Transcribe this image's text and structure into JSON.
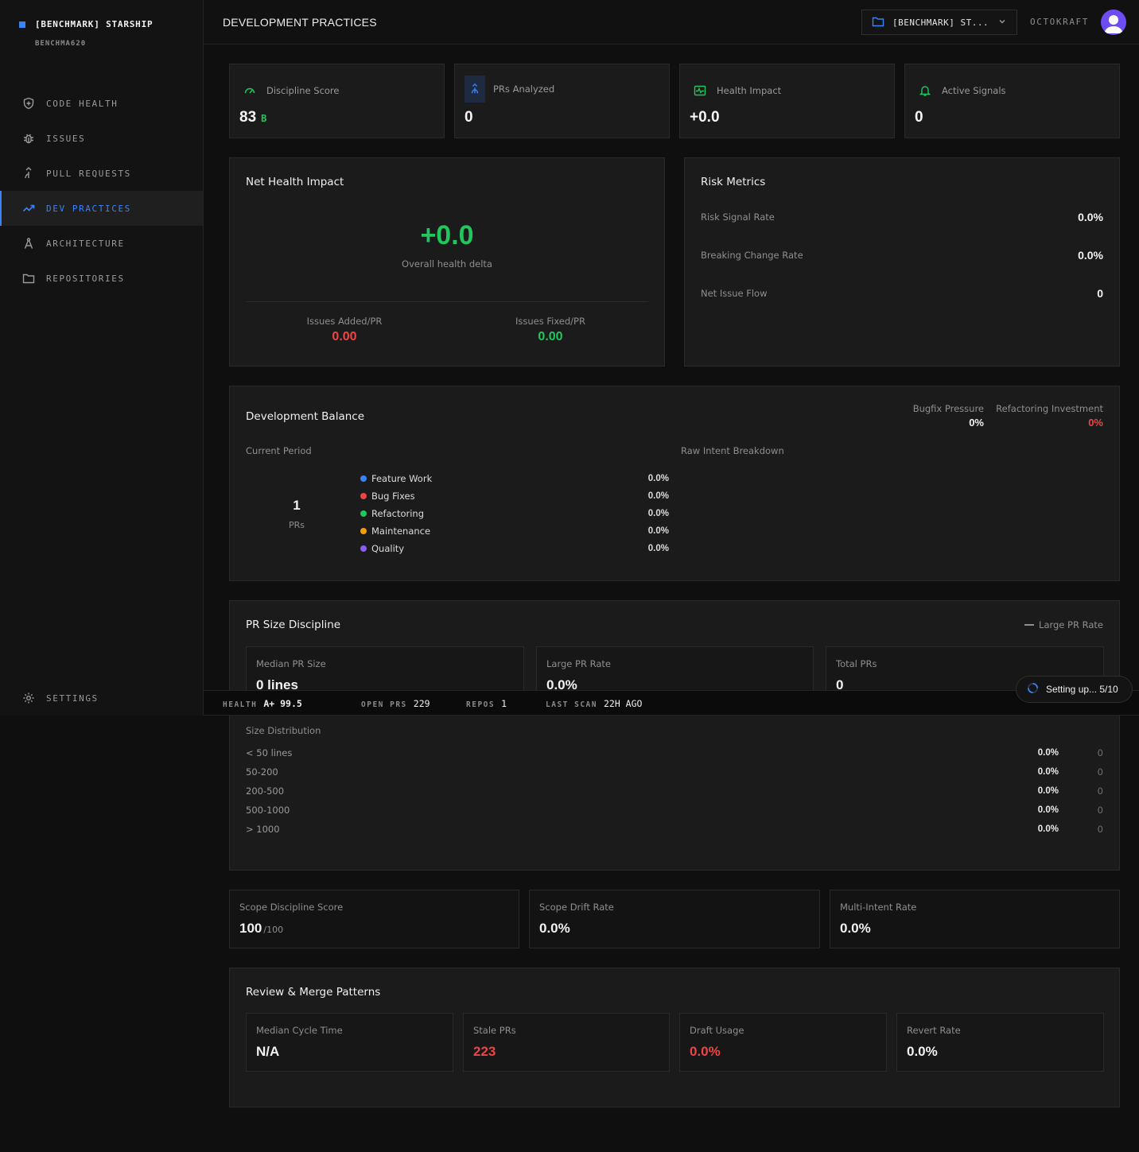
{
  "brand": {
    "name": "[BENCHMARK] STARSHIP",
    "sub": "BENCHMA620"
  },
  "nav": [
    {
      "label": "CODE HEALTH",
      "icon": "shield-icon"
    },
    {
      "label": "ISSUES",
      "icon": "bug-icon"
    },
    {
      "label": "PULL REQUESTS",
      "icon": "merge-icon"
    },
    {
      "label": "DEV PRACTICES",
      "icon": "trend-icon",
      "active": true
    },
    {
      "label": "ARCHITECTURE",
      "icon": "compass-icon"
    },
    {
      "label": "REPOSITORIES",
      "icon": "folder-icon"
    }
  ],
  "settings_label": "SETTINGS",
  "topbar": {
    "title": "DEVELOPMENT PRACTICES",
    "repo": "[BENCHMARK] ST...",
    "user": "OCTOKRAFT"
  },
  "stats": [
    {
      "label": "Discipline Score",
      "value": "83",
      "grade": "B"
    },
    {
      "label": "PRs Analyzed",
      "value": "0"
    },
    {
      "label": "Health Impact",
      "value": "+0.0"
    },
    {
      "label": "Active Signals",
      "value": "0"
    }
  ],
  "net_health": {
    "title": "Net Health Impact",
    "delta": "+0.0",
    "delta_label": "Overall health delta",
    "added_label": "Issues Added/PR",
    "added_value": "0.00",
    "fixed_label": "Issues Fixed/PR",
    "fixed_value": "0.00"
  },
  "risk": {
    "title": "Risk Metrics",
    "rows": [
      {
        "label": "Risk Signal Rate",
        "value": "0.0%"
      },
      {
        "label": "Breaking Change Rate",
        "value": "0.0%"
      },
      {
        "label": "Net Issue Flow",
        "value": "0"
      }
    ]
  },
  "balance": {
    "title": "Development Balance",
    "bugfix_label": "Bugfix Pressure",
    "bugfix_value": "0%",
    "refactor_label": "Refactoring Investment",
    "refactor_value": "0%",
    "current_period": "Current Period",
    "raw_breakdown": "Raw Intent Breakdown",
    "pr_count": "1",
    "pr_unit": "PRs",
    "legend": [
      {
        "name": "Feature Work",
        "value": "0.0%",
        "color": "#3b82f6"
      },
      {
        "name": "Bug Fixes",
        "value": "0.0%",
        "color": "#ef4444"
      },
      {
        "name": "Refactoring",
        "value": "0.0%",
        "color": "#22c55e"
      },
      {
        "name": "Maintenance",
        "value": "0.0%",
        "color": "#f59e0b"
      },
      {
        "name": "Quality",
        "value": "0.0%",
        "color": "#8b5cf6"
      }
    ]
  },
  "pr_size": {
    "title": "PR Size Discipline",
    "legend_label": "Large PR Rate",
    "cards": [
      {
        "label": "Median PR Size",
        "value": "0 lines"
      },
      {
        "label": "Large PR Rate",
        "value": "0.0%"
      },
      {
        "label": "Total PRs",
        "value": "0"
      }
    ],
    "dist_title": "Size Distribution",
    "dist": [
      {
        "label": "< 50 lines",
        "pct": "0.0%",
        "count": "0"
      },
      {
        "label": "50-200",
        "pct": "0.0%",
        "count": "0"
      },
      {
        "label": "200-500",
        "pct": "0.0%",
        "count": "0"
      },
      {
        "label": "500-1000",
        "pct": "0.0%",
        "count": "0"
      },
      {
        "label": "> 1000",
        "pct": "0.0%",
        "count": "0"
      }
    ]
  },
  "scope": [
    {
      "label": "Scope Discipline Score",
      "value": "100",
      "suffix": "/100"
    },
    {
      "label": "Scope Drift Rate",
      "value": "0.0%"
    },
    {
      "label": "Multi-Intent Rate",
      "value": "0.0%"
    }
  ],
  "review": {
    "title": "Review & Merge Patterns",
    "cards": [
      {
        "label": "Median Cycle Time",
        "value": "N/A"
      },
      {
        "label": "Stale PRs",
        "value": "223"
      },
      {
        "label": "Draft Usage",
        "value": "0.0%"
      },
      {
        "label": "Revert Rate",
        "value": "0.0%"
      }
    ]
  },
  "statusbar": {
    "health_label": "HEALTH",
    "health_value": "A+ 99.5",
    "open_prs_label": "OPEN PRS",
    "open_prs_value": "229",
    "repos_label": "REPOS",
    "repos_value": "1",
    "last_scan_label": "LAST SCAN",
    "last_scan_value": "22H AGO"
  },
  "toast": "Setting up... 5/10",
  "colors": {
    "accent": "#3b82f6",
    "positive": "#22c55e",
    "negative": "#ef4444"
  }
}
